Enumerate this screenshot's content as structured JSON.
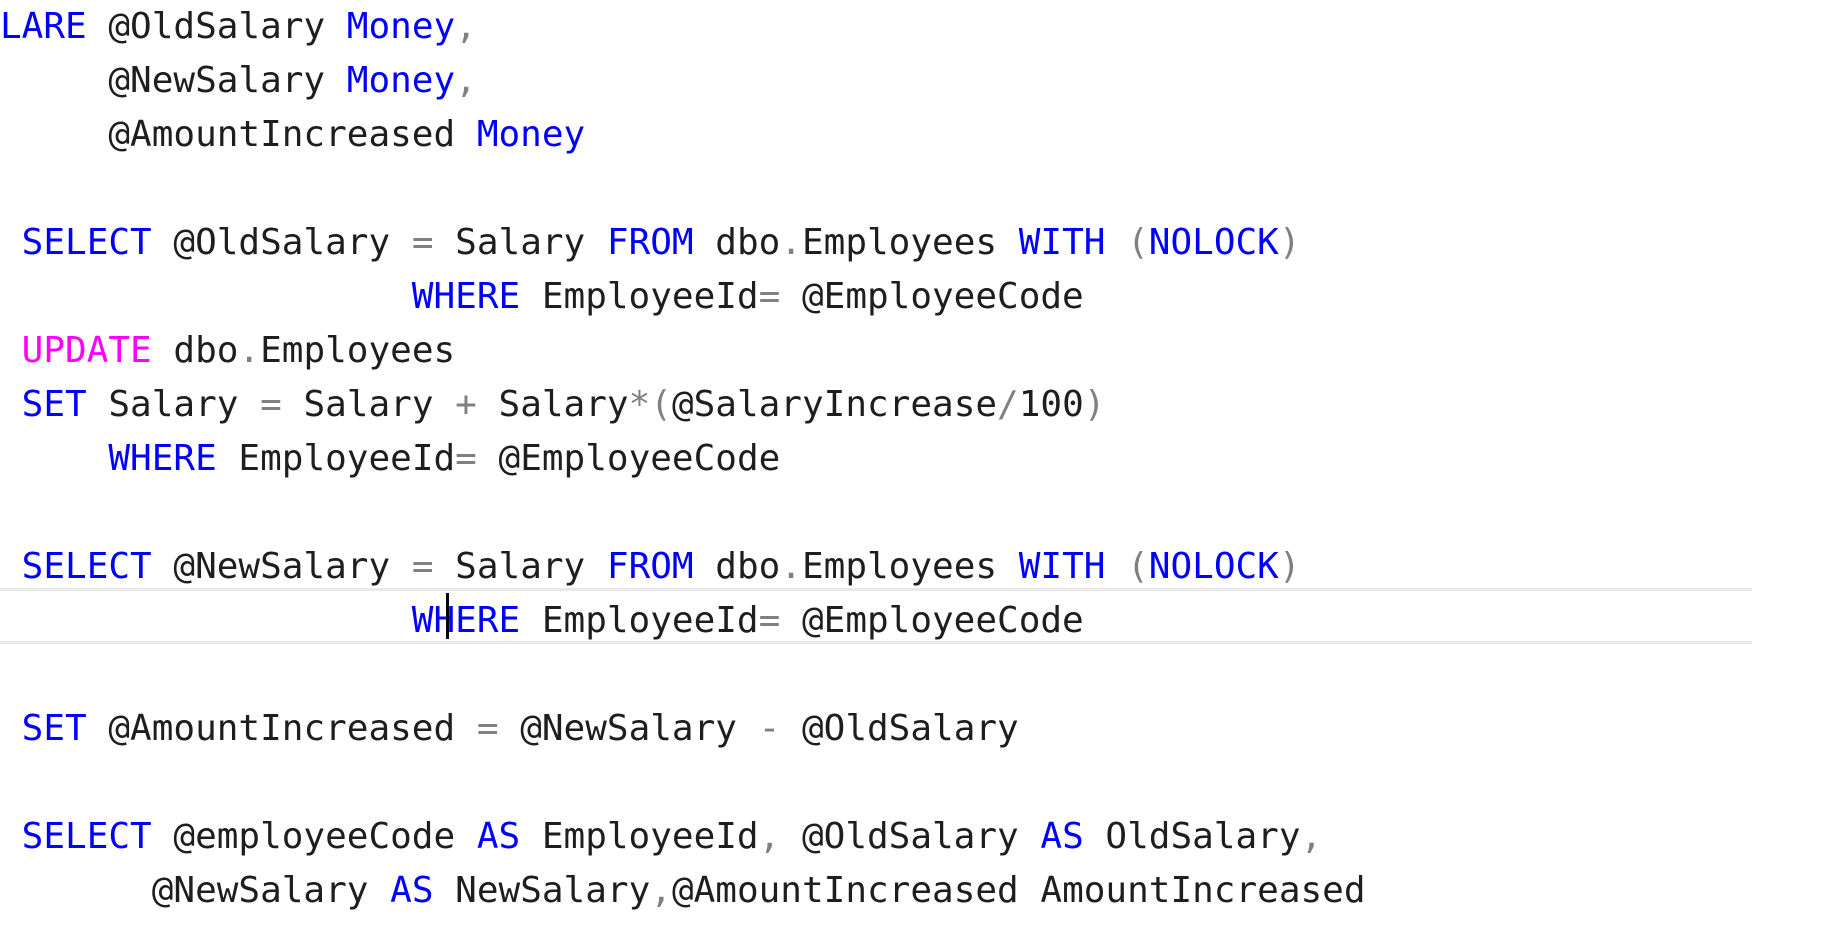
{
  "editor": {
    "colors": {
      "keyword": "#0000ff",
      "dml_keyword": "#ff00ff",
      "operator": "#808080",
      "identifier": "#1e1e1e",
      "current_line_border": "#e9e9e9"
    },
    "lines": [
      [
        {
          "t": "LARE ",
          "c": "kw"
        },
        {
          "t": "@OldSalary ",
          "c": "id"
        },
        {
          "t": "Money",
          "c": "kw"
        },
        {
          "t": ",",
          "c": "op"
        }
      ],
      [
        {
          "t": "     @NewSalary ",
          "c": "id"
        },
        {
          "t": "Money",
          "c": "kw"
        },
        {
          "t": ",",
          "c": "op"
        }
      ],
      [
        {
          "t": "     @AmountIncreased ",
          "c": "id"
        },
        {
          "t": "Money",
          "c": "kw"
        }
      ],
      [],
      [
        {
          "t": " SELECT ",
          "c": "kw"
        },
        {
          "t": "@OldSalary ",
          "c": "id"
        },
        {
          "t": "= ",
          "c": "op"
        },
        {
          "t": "Salary ",
          "c": "id"
        },
        {
          "t": "FROM ",
          "c": "kw"
        },
        {
          "t": "dbo",
          "c": "id"
        },
        {
          "t": ".",
          "c": "op"
        },
        {
          "t": "Employees ",
          "c": "id"
        },
        {
          "t": "WITH ",
          "c": "kw"
        },
        {
          "t": "(",
          "c": "op"
        },
        {
          "t": "NOLOCK",
          "c": "kw"
        },
        {
          "t": ")",
          "c": "op"
        }
      ],
      [
        {
          "t": "                   WHERE ",
          "c": "kw"
        },
        {
          "t": "EmployeeId",
          "c": "id"
        },
        {
          "t": "= ",
          "c": "op"
        },
        {
          "t": "@EmployeeCode",
          "c": "id"
        }
      ],
      [
        {
          "t": " UPDATE ",
          "c": "kw2"
        },
        {
          "t": "dbo",
          "c": "id"
        },
        {
          "t": ".",
          "c": "op"
        },
        {
          "t": "Employees",
          "c": "id"
        }
      ],
      [
        {
          "t": " SET ",
          "c": "kw"
        },
        {
          "t": "Salary ",
          "c": "id"
        },
        {
          "t": "= ",
          "c": "op"
        },
        {
          "t": "Salary ",
          "c": "id"
        },
        {
          "t": "+ ",
          "c": "op"
        },
        {
          "t": "Salary",
          "c": "id"
        },
        {
          "t": "*(",
          "c": "op"
        },
        {
          "t": "@SalaryIncrease",
          "c": "id"
        },
        {
          "t": "/",
          "c": "op"
        },
        {
          "t": "100",
          "c": "id"
        },
        {
          "t": ")",
          "c": "op"
        }
      ],
      [
        {
          "t": "     WHERE ",
          "c": "kw"
        },
        {
          "t": "EmployeeId",
          "c": "id"
        },
        {
          "t": "= ",
          "c": "op"
        },
        {
          "t": "@EmployeeCode",
          "c": "id"
        }
      ],
      [],
      [
        {
          "t": " SELECT ",
          "c": "kw"
        },
        {
          "t": "@NewSalary ",
          "c": "id"
        },
        {
          "t": "= ",
          "c": "op"
        },
        {
          "t": "Salary ",
          "c": "id"
        },
        {
          "t": "FROM ",
          "c": "kw"
        },
        {
          "t": "dbo",
          "c": "id"
        },
        {
          "t": ".",
          "c": "op"
        },
        {
          "t": "Employees ",
          "c": "id"
        },
        {
          "t": "WITH ",
          "c": "kw"
        },
        {
          "t": "(",
          "c": "op"
        },
        {
          "t": "NOLOCK",
          "c": "kw"
        },
        {
          "t": ")",
          "c": "op"
        }
      ],
      [
        {
          "t": "                   WHERE ",
          "c": "kw"
        },
        {
          "t": "EmployeeId",
          "c": "id"
        },
        {
          "t": "= ",
          "c": "op"
        },
        {
          "t": "@EmployeeCode",
          "c": "id"
        }
      ],
      [],
      [
        {
          "t": " SET ",
          "c": "kw"
        },
        {
          "t": "@AmountIncreased ",
          "c": "id"
        },
        {
          "t": "= ",
          "c": "op"
        },
        {
          "t": "@NewSalary ",
          "c": "id"
        },
        {
          "t": "- ",
          "c": "op"
        },
        {
          "t": "@OldSalary",
          "c": "id"
        }
      ],
      [],
      [
        {
          "t": " SELECT ",
          "c": "kw"
        },
        {
          "t": "@employeeCode ",
          "c": "id"
        },
        {
          "t": "AS ",
          "c": "kw"
        },
        {
          "t": "EmployeeId",
          "c": "id"
        },
        {
          "t": ", ",
          "c": "op"
        },
        {
          "t": "@OldSalary ",
          "c": "id"
        },
        {
          "t": "AS ",
          "c": "kw"
        },
        {
          "t": "OldSalary",
          "c": "id"
        },
        {
          "t": ",",
          "c": "op"
        }
      ],
      [
        {
          "t": "       @NewSalary ",
          "c": "id"
        },
        {
          "t": "AS ",
          "c": "kw"
        },
        {
          "t": "NewSalary",
          "c": "id"
        },
        {
          "t": ",",
          "c": "op"
        },
        {
          "t": "@AmountIncreased ",
          "c": "id"
        },
        {
          "t": "AmountIncreased",
          "c": "id"
        }
      ]
    ]
  }
}
